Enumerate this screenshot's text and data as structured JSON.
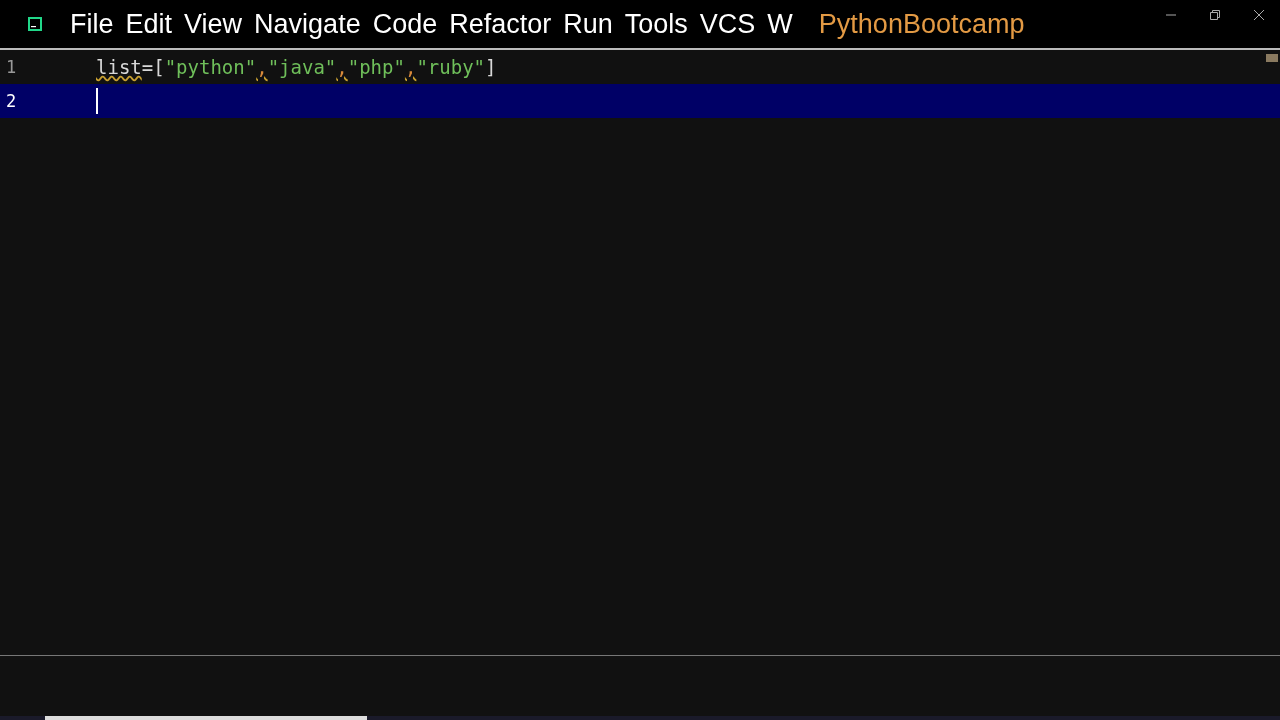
{
  "menu_bar": {
    "items": [
      "File",
      "Edit",
      "View",
      "Navigate",
      "Code",
      "Refactor",
      "Run",
      "Tools",
      "VCS",
      "W"
    ],
    "project_title": "PythonBootcamp"
  },
  "editor": {
    "lines": [
      {
        "number": "1",
        "current": false,
        "caret": false,
        "tokens": [
          {
            "kind": "identifier",
            "text": "list",
            "warning": true
          },
          {
            "kind": "operator",
            "text": "=[",
            "warning": false
          },
          {
            "kind": "string",
            "text": "\"python\"",
            "warning": false
          },
          {
            "kind": "comma",
            "text": ",",
            "warning": true
          },
          {
            "kind": "string",
            "text": "\"java\"",
            "warning": false
          },
          {
            "kind": "comma",
            "text": ",",
            "warning": true
          },
          {
            "kind": "string",
            "text": "\"php\"",
            "warning": false
          },
          {
            "kind": "comma",
            "text": ",",
            "warning": true
          },
          {
            "kind": "string",
            "text": "\"ruby\"",
            "warning": false
          },
          {
            "kind": "operator",
            "text": "]",
            "warning": false
          }
        ]
      },
      {
        "number": "2",
        "current": true,
        "caret": true
      }
    ]
  }
}
